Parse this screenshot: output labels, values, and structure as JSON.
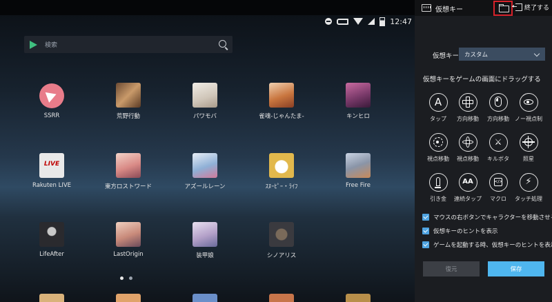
{
  "emulator": {
    "status_bar": {
      "time": "12:47"
    },
    "search": {
      "placeholder": "検索"
    },
    "apps": [
      {
        "label": "SSRR",
        "color": "#e87c8a"
      },
      {
        "label": "荒野行動",
        "color": "#b07a4a"
      },
      {
        "label": "パワモバ",
        "color": "#d9d2c8"
      },
      {
        "label": "雀魂-じゃんたま-",
        "color": "#c9763f"
      },
      {
        "label": "キンヒロ",
        "color": "#7a3a6a"
      },
      {
        "label": "Rakuten LIVE",
        "color": "#e9e9e9"
      },
      {
        "label": "東方ロストワード",
        "color": "#d98a86"
      },
      {
        "label": "アズールレーン",
        "color": "#8fb0d6"
      },
      {
        "label": "ｽﾇｰﾋﾟｰ・ﾗｲﾌ",
        "color": "#e2b84c"
      },
      {
        "label": "Free Fire",
        "color": "#8a95a8"
      },
      {
        "label": "LifeAfter",
        "color": "#2a2a2e"
      },
      {
        "label": "LastOrigin",
        "color": "#c88a7a"
      },
      {
        "label": "装甲娘",
        "color": "#b3a0c8"
      },
      {
        "label": "シノアリス",
        "color": "#3a3a3f"
      }
    ],
    "rakuten_icon_text": "LIVE",
    "bottom_peek_colors": [
      "#d9b27a",
      "#e0a36a",
      "#6a8fc9",
      "#c7754a",
      "#b88f4a"
    ]
  },
  "panel": {
    "header": {
      "title": "仮想キー",
      "exit_label": "終了する"
    },
    "key_type": {
      "label": "仮想キー",
      "value": "カスタム"
    },
    "drag_instruction": "仮想キーをゲームの画面にドラッグする",
    "keys": [
      {
        "label": "タップ",
        "icon": "A"
      },
      {
        "label": "方向移動",
        "icon": "dpad"
      },
      {
        "label": "方向移動",
        "icon": "mouse"
      },
      {
        "label": "ノー視点制",
        "icon": "eye"
      },
      {
        "label": "視点移動",
        "icon": "rotate"
      },
      {
        "label": "視点移動",
        "icon": "joystick"
      },
      {
        "label": "キルボタ",
        "icon": "swords"
      },
      {
        "label": "照星",
        "icon": "crosshair"
      },
      {
        "label": "引き金",
        "icon": "bullet"
      },
      {
        "label": "連続タップ",
        "icon": "AA"
      },
      {
        "label": "マクロ",
        "icon": "macro"
      },
      {
        "label": "タッチ処理",
        "icon": "bolt"
      }
    ],
    "options": [
      {
        "label": "マウスの右ボタンでキャラクターを移動させる",
        "checked": true
      },
      {
        "label": "仮想キーのヒントを表示",
        "checked": true
      },
      {
        "label": "ゲームを起動する時、仮想キーのヒントを表示",
        "checked": true
      }
    ],
    "restore_label": "復元",
    "save_label": "保存"
  }
}
